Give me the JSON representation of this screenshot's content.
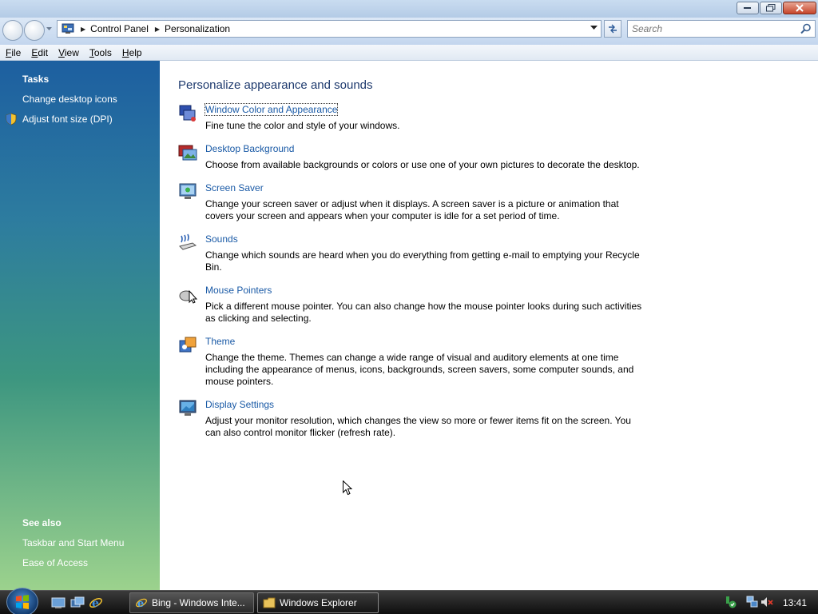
{
  "window": {
    "controls": [
      "minimize",
      "maximize",
      "close"
    ]
  },
  "address": {
    "crumbs": [
      "Control Panel",
      "Personalization"
    ],
    "search_placeholder": "Search"
  },
  "menu": {
    "items": [
      {
        "key": "F",
        "rest": "ile"
      },
      {
        "key": "E",
        "rest": "dit"
      },
      {
        "key": "V",
        "rest": "iew"
      },
      {
        "key": "T",
        "rest": "ools"
      },
      {
        "key": "H",
        "rest": "elp"
      }
    ]
  },
  "sidebar": {
    "tasks_heading": "Tasks",
    "tasks": [
      "Change desktop icons",
      "Adjust font size (DPI)"
    ],
    "see_also_heading": "See also",
    "see_also": [
      "Taskbar and Start Menu",
      "Ease of Access"
    ]
  },
  "main": {
    "title": "Personalize appearance and sounds",
    "tasks": [
      {
        "link": "Window Color and Appearance",
        "desc": "Fine tune the color and style of your windows.",
        "icon": "window-color-icon"
      },
      {
        "link": "Desktop Background",
        "desc": "Choose from available backgrounds or colors or use one of your own pictures to decorate the desktop.",
        "icon": "desktop-background-icon"
      },
      {
        "link": "Screen Saver",
        "desc": "Change your screen saver or adjust when it displays. A screen saver is a picture or animation that covers your screen and appears when your computer is idle for a set period of time.",
        "icon": "screen-saver-icon"
      },
      {
        "link": "Sounds",
        "desc": "Change which sounds are heard when you do everything from getting e-mail to emptying your Recycle Bin.",
        "icon": "sounds-icon"
      },
      {
        "link": "Mouse Pointers",
        "desc": "Pick a different mouse pointer. You can also change how the mouse pointer looks during such activities as clicking and selecting.",
        "icon": "mouse-pointers-icon"
      },
      {
        "link": "Theme",
        "desc": "Change the theme. Themes can change a wide range of visual and auditory elements at one time including the appearance of menus, icons, backgrounds, screen savers, some computer sounds, and mouse pointers.",
        "icon": "theme-icon"
      },
      {
        "link": "Display Settings",
        "desc": "Adjust your monitor resolution, which changes the view so more or fewer items fit on the screen. You can also control monitor flicker (refresh rate).",
        "icon": "display-settings-icon"
      }
    ]
  },
  "taskbar": {
    "buttons": [
      {
        "label": "Bing - Windows Inte...",
        "icon": "internet-explorer-icon"
      },
      {
        "label": "Windows Explorer",
        "icon": "folder-icon"
      }
    ],
    "clock": "13:41"
  }
}
